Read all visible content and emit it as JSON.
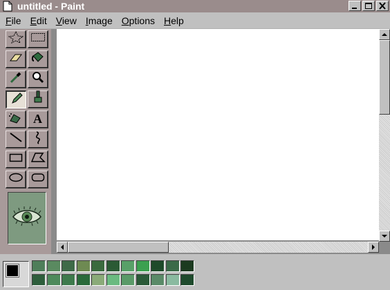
{
  "window": {
    "title": "untitled - Paint",
    "minimize_icon": "minimize-icon",
    "maximize_icon": "maximize-icon",
    "close_icon": "close-icon"
  },
  "menu": [
    {
      "accel": "F",
      "rest": "ile"
    },
    {
      "accel": "E",
      "rest": "dit"
    },
    {
      "accel": "V",
      "rest": "iew"
    },
    {
      "accel": "I",
      "rest": "mage"
    },
    {
      "accel": "O",
      "rest": "ptions"
    },
    {
      "accel": "H",
      "rest": "elp"
    }
  ],
  "tools": [
    {
      "name": "free-form-select",
      "icon": "star-select-icon"
    },
    {
      "name": "rectangle-select",
      "icon": "rect-select-icon"
    },
    {
      "name": "eraser",
      "icon": "eraser-icon"
    },
    {
      "name": "fill",
      "icon": "paint-bucket-icon"
    },
    {
      "name": "pick-color",
      "icon": "eyedropper-icon"
    },
    {
      "name": "magnifier",
      "icon": "magnifier-icon"
    },
    {
      "name": "pencil",
      "icon": "pencil-icon",
      "selected": true
    },
    {
      "name": "brush",
      "icon": "brush-icon"
    },
    {
      "name": "airbrush",
      "icon": "airbrush-icon"
    },
    {
      "name": "text",
      "icon": "text-icon",
      "label": "A"
    },
    {
      "name": "line",
      "icon": "line-icon"
    },
    {
      "name": "curve",
      "icon": "curve-icon"
    },
    {
      "name": "rectangle",
      "icon": "rectangle-icon"
    },
    {
      "name": "polygon",
      "icon": "polygon-icon"
    },
    {
      "name": "ellipse",
      "icon": "ellipse-icon"
    },
    {
      "name": "rounded-rectangle",
      "icon": "rounded-rect-icon"
    }
  ],
  "tool_options": {
    "icon": "eye-icon",
    "background": "#7e9a80"
  },
  "colors": {
    "foreground": "#000000",
    "background": "#ffffff",
    "palette_top": [
      "#4e7e5a",
      "#5a8a60",
      "#3e6a48",
      "#6e8a52",
      "#3a6a3e",
      "#2a5a34",
      "#58a068",
      "#3ca050",
      "#1e4a2a",
      "#3a6a48",
      "#1c3a20"
    ],
    "palette_bottom": [
      "#2e5e3c",
      "#4e8a5c",
      "#3e7a4c",
      "#2a6a3a",
      "#8aaa78",
      "#6aba80",
      "#5a9a68",
      "#2a5a38",
      "#5a8a68",
      "#8abaa0",
      "#1e4a2c"
    ]
  }
}
